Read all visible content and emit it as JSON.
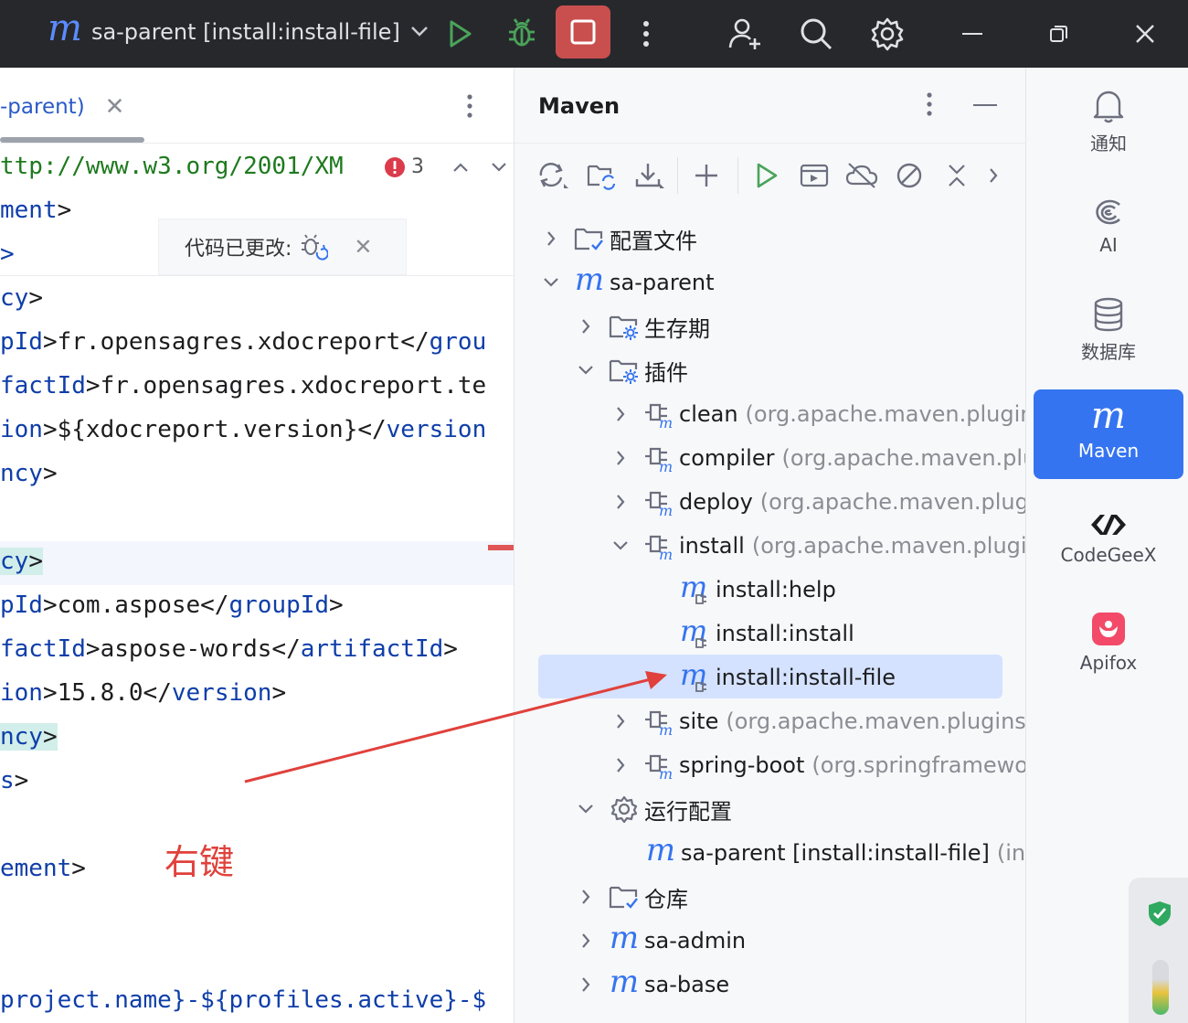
{
  "titlebar": {
    "project_label": "sa-parent [install:install-file]"
  },
  "editor": {
    "tab_label": "-parent)",
    "close_glyph": "✕",
    "warning_count": "3",
    "notice_text": "代码已更改:",
    "annotation": "右键",
    "lines": [
      {
        "a": "ttp://www.w3.org/2001/XM",
        "t": "str"
      },
      {
        "a": "ment",
        "b": ">"
      },
      {
        "a": ">"
      },
      {
        "a": "cy",
        "b": ">"
      },
      {
        "a": "pId",
        "b": ">fr.opensagres.xdocreport</",
        "c": "grou"
      },
      {
        "a": "factId",
        "b": ">fr.opensagres.xdocreport.te"
      },
      {
        "a": "ion",
        "b": ">${xdocreport.version}</",
        "c": "version"
      },
      {
        "a": "ncy",
        "b": ">"
      },
      {
        "a": ""
      },
      {
        "a": "cy",
        "b": ">"
      },
      {
        "a": "pId",
        "b": ">com.aspose</",
        "c": "groupId",
        "d": ">"
      },
      {
        "a": "factId",
        "b": ">aspose-words</",
        "c": "artifactId",
        "d": ">"
      },
      {
        "a": "ion",
        "b": ">15.8.0</",
        "c": "version",
        "d": ">"
      },
      {
        "a": "ncy",
        "b": ">"
      },
      {
        "a": "s",
        "b": ">"
      },
      {
        "a": ""
      },
      {
        "a": "ement",
        "b": ">"
      },
      {
        "a": ""
      },
      {
        "a": ""
      },
      {
        "a": "project.name}-${profiles.active}-$"
      }
    ]
  },
  "maven": {
    "title": "Maven",
    "tree": {
      "config_files": "配置文件",
      "sa_parent": "sa-parent",
      "lifecycle": "生存期",
      "plugins": "插件",
      "clean": "clean",
      "clean_detail": "(org.apache.maven.plugins:",
      "compiler": "compiler",
      "compiler_detail": "(org.apache.maven.plug",
      "deploy": "deploy",
      "deploy_detail": "(org.apache.maven.plugir",
      "install": "install",
      "install_detail": "(org.apache.maven.plugins",
      "install_help": "install:help",
      "install_install": "install:install",
      "install_file": "install:install-file",
      "site": "site",
      "site_detail": "(org.apache.maven.plugins:m",
      "spring_boot": "spring-boot",
      "spring_boot_detail": "(org.springframewor",
      "run_configs": "运行配置",
      "run_item": "sa-parent [install:install-file]",
      "run_item_detail": "(insta",
      "repositories": "仓库",
      "sa_admin": "sa-admin",
      "sa_base": "sa-base"
    }
  },
  "rightbar": {
    "notifications": "通知",
    "ai": "AI",
    "database": "数据库",
    "maven": "Maven",
    "codegeex": "CodeGeeX",
    "apifox": "Apifox"
  },
  "colors": {
    "titlebar_bg": "#27282c",
    "accent": "#3574f0",
    "stop_button": "#c94f4f",
    "run_green": "#4aa35a",
    "selection": "#d4e2ff",
    "annotation_red": "#e0413c"
  }
}
